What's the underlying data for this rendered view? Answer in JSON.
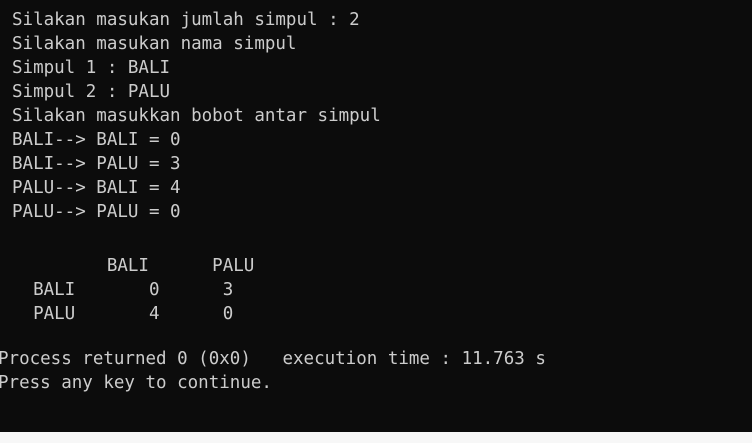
{
  "console": {
    "lines": [
      "Silakan masukan jumlah simpul : 2",
      "Silakan masukan nama simpul",
      "Simpul 1 : BALI",
      "Simpul 2 : PALU",
      "Silakan masukkan bobot antar simpul",
      "BALI--> BALI = 0",
      "BALI--> PALU = 3",
      "PALU--> BALI = 4",
      "PALU--> PALU = 0",
      "",
      "         BALI      PALU",
      "  BALI       0      3",
      "  PALU       4      0",
      "",
      "Process returned 0 (0x0)   execution time : 11.763 s",
      "Press any key to continue."
    ]
  },
  "colors": {
    "background": "#0c0c0c",
    "text": "#cccccc",
    "strip": "#f7f7f7"
  }
}
